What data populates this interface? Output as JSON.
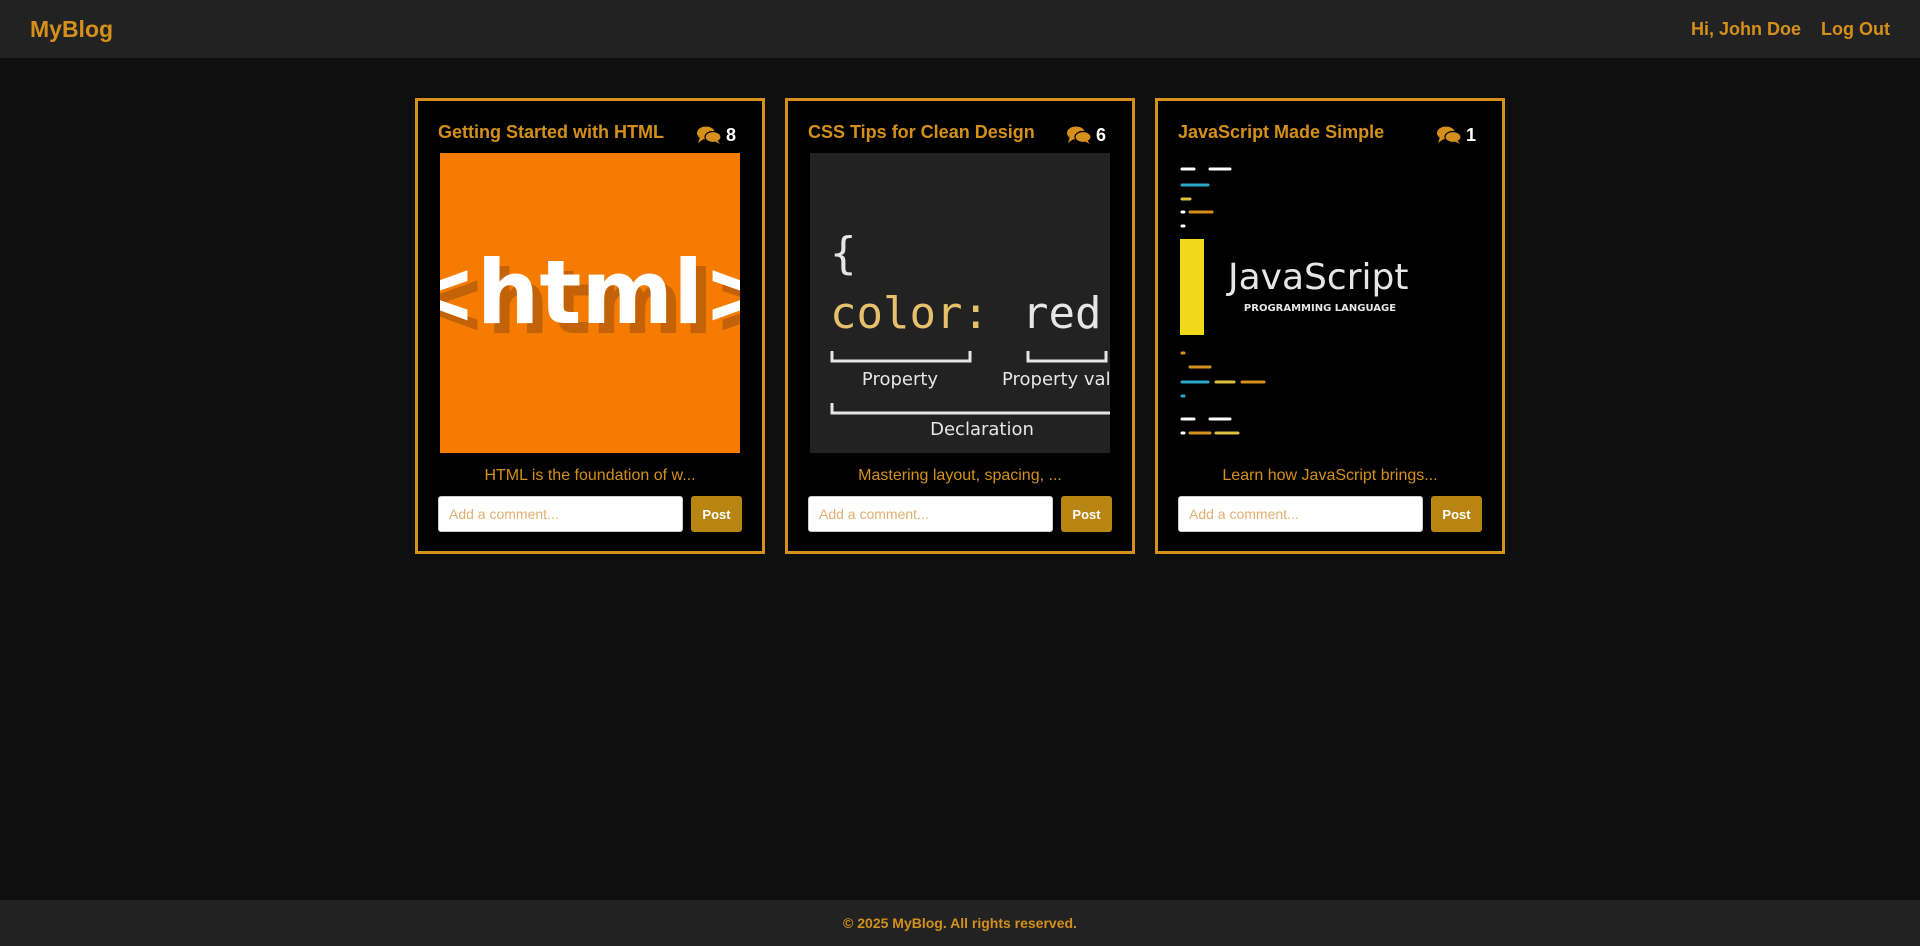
{
  "navbar": {
    "brand": "MyBlog",
    "greeting": "Hi, John Doe",
    "logout": "Log Out"
  },
  "posts": [
    {
      "title": "Getting Started with HTML",
      "comment_count": "8",
      "excerpt": "HTML is the foundation of w...",
      "comment_placeholder": "Add a comment...",
      "post_label": "Post",
      "image_text": "<html>"
    },
    {
      "title": "CSS Tips for Clean Design",
      "comment_count": "6",
      "excerpt": "Mastering layout, spacing, ...",
      "comment_placeholder": "Add a comment...",
      "post_label": "Post",
      "image_brace": "{",
      "image_property": "color:",
      "image_value": "red;",
      "image_property_label": "Property",
      "image_value_label": "Property value",
      "image_declaration_label": "Declaration"
    },
    {
      "title": "JavaScript Made Simple",
      "comment_count": "1",
      "excerpt": "Learn how JavaScript brings...",
      "comment_placeholder": "Add a comment...",
      "post_label": "Post",
      "image_title": "JavaScript",
      "image_subtitle": "PROGRAMMING LANGUAGE"
    }
  ],
  "footer": {
    "text": "© 2025 MyBlog. All rights reserved."
  },
  "icons": {
    "comments": "comments-icon"
  },
  "colors": {
    "accent": "#d4901a",
    "button": "#b88412",
    "background": "#0f0f0f",
    "bar": "#222222"
  }
}
